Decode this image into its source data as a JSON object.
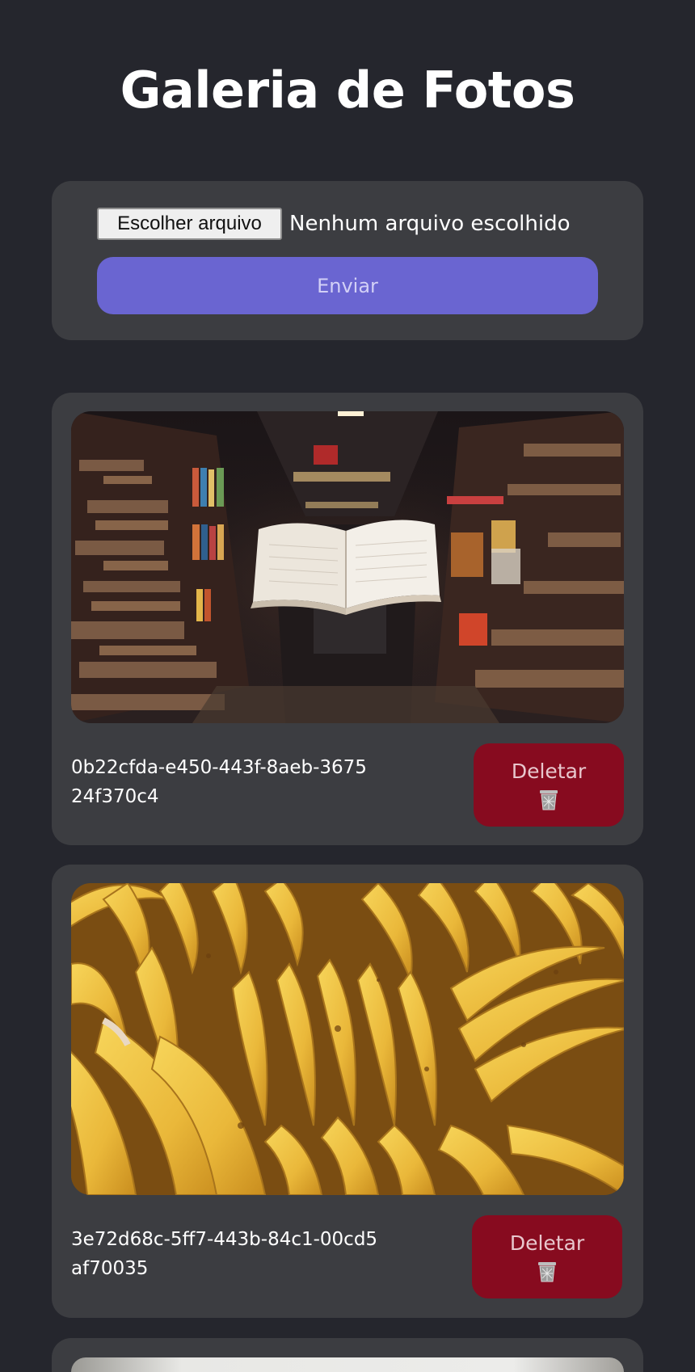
{
  "header": {
    "title": "Galeria de Fotos"
  },
  "upload": {
    "file_button_label": "Escolher arquivo",
    "file_status": "Nenhum arquivo escolhido",
    "submit_label": "Enviar"
  },
  "photos": [
    {
      "id": "0b22cfda-e450-443f-8aeb-367524f370c4",
      "image": "library-floating-book-photo",
      "delete_label": "Deletar",
      "delete_icon": "trash-icon"
    },
    {
      "id": "3e72d68c-5ff7-443b-84c1-00cd5af70035",
      "image": "bananas-photo",
      "delete_label": "Deletar",
      "delete_icon": "trash-icon"
    },
    {
      "image": "partially-visible-photo"
    }
  ],
  "colors": {
    "background": "#25262d",
    "card": "#3c3d41",
    "primary": "#6a65d1",
    "danger": "#870b1f"
  }
}
